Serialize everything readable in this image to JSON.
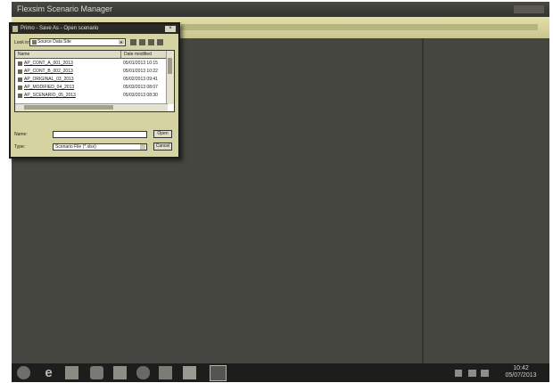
{
  "window": {
    "title": "Flexsim Scenario Manager"
  },
  "dialog": {
    "title": "Primo - Save As - Open scenario",
    "close_label": "×",
    "look_in_label": "Look in:",
    "look_in_value": "Source Data Site",
    "columns": [
      "Name",
      "Date modified"
    ],
    "files": [
      {
        "name": "AP_CONT_A_001_2013",
        "date": "05/01/2013 10:15"
      },
      {
        "name": "AP_CONT_B_002_2013",
        "date": "05/01/2013 10:22"
      },
      {
        "name": "AP_ORIGINAL_03_2013",
        "date": "05/02/2013 09:41"
      },
      {
        "name": "AP_MODIFIED_04_2013",
        "date": "05/03/2013 08:07"
      },
      {
        "name": "AP_SCENARIO_05_2013",
        "date": "05/03/2013 08:30"
      }
    ],
    "name_label": "Name:",
    "name_value": "",
    "type_label": "Type:",
    "type_value": "Scenario File (*.xlsx)",
    "open_label": "Open",
    "cancel_label": "Cancel"
  },
  "taskbar": {
    "ie_glyph": "e",
    "time": "10:42",
    "date": "05/07/2013"
  }
}
